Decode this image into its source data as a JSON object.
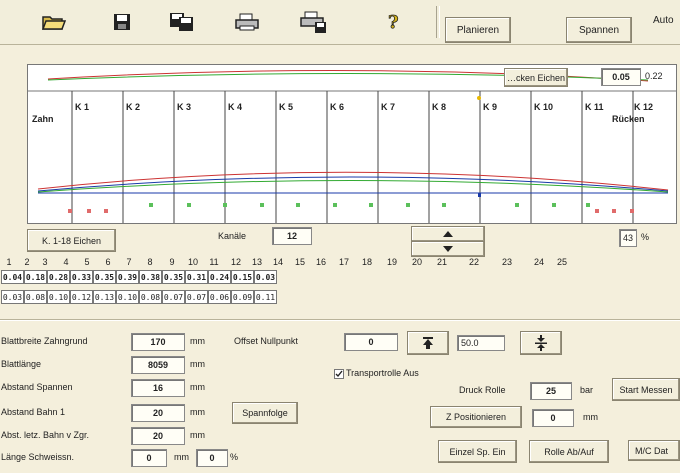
{
  "toolbar": {
    "planieren_label": "Planieren",
    "spannen_label": "Spannen",
    "auto_label": "Auto",
    "icons": [
      "open-folder-icon",
      "save-icon",
      "save-all-icon",
      "print-icon",
      "print-preview-icon",
      "help-icon"
    ]
  },
  "plot": {
    "eichen_button": "…cken Eichen",
    "value_a": "0.05",
    "value_b": "0.22",
    "zahn_label": "Zahn",
    "ruecken_label": "Rücken",
    "channels": [
      "K 1",
      "K 2",
      "K 3",
      "K 4",
      "K 5",
      "K 6",
      "K 7",
      "K 8",
      "K 9",
      "K 10",
      "K 11",
      "K 12"
    ]
  },
  "controls": {
    "eichen_18_label": "K. 1-18 Eichen",
    "kanaele_label": "Kanäle",
    "kanaele_value": "12",
    "percent_value": "43",
    "percent_unit": "%"
  },
  "table": {
    "numbers": [
      "1",
      "2",
      "3",
      "4",
      "5",
      "6",
      "7",
      "8",
      "9",
      "10",
      "11",
      "12",
      "13",
      "14",
      "15",
      "16",
      "17",
      "18",
      "19",
      "20",
      "21",
      "22",
      "23",
      "24",
      "25"
    ],
    "row_bold": [
      "0.04",
      "0.18",
      "0.28",
      "0.33",
      "0.35",
      "0.39",
      "0.38",
      "0.35",
      "0.31",
      "0.24",
      "0.15",
      "0.03"
    ],
    "row_plain": [
      "0.03",
      "0.08",
      "0.10",
      "0.12",
      "0.13",
      "0.10",
      "0.08",
      "0.07",
      "0.07",
      "0.06",
      "0.09",
      "0.11"
    ]
  },
  "params": {
    "blattbreite_label": "Blattbreite Zahngrund",
    "blattbreite_value": "170",
    "blattlaenge_label": "Blattlänge",
    "blattlaenge_value": "8059",
    "abstand_spannen_label": "Abstand Spannen",
    "abstand_spannen_value": "16",
    "abstand_bahn_label": "Abstand Bahn 1",
    "abstand_bahn_value": "20",
    "abst_letz_label": "Abst. letz. Bahn v Zgr.",
    "abst_letz_value": "20",
    "laenge_label": "Länge Schweissn.",
    "laenge_value_a": "0",
    "laenge_value_b": "0",
    "unit_mm": "mm",
    "unit_percent": "%",
    "offset_label": "Offset Nullpunkt",
    "offset_value": "0",
    "offset_field": "50.0",
    "transport_label": "Transportrolle Aus",
    "druck_label": "Druck Rolle",
    "druck_value": "25",
    "druck_unit": "bar",
    "z_pos_value": "0",
    "z_pos_unit": "mm"
  },
  "buttons": {
    "spannfolge": "Spannfolge",
    "start_messen": "Start Messen",
    "z_positionieren": "Z Positionieren",
    "einzel_sp_ein": "Einzel Sp. Ein",
    "rolle_ab_auf": "Rolle Ab/Auf",
    "mc_dat": "M/C Dat"
  }
}
